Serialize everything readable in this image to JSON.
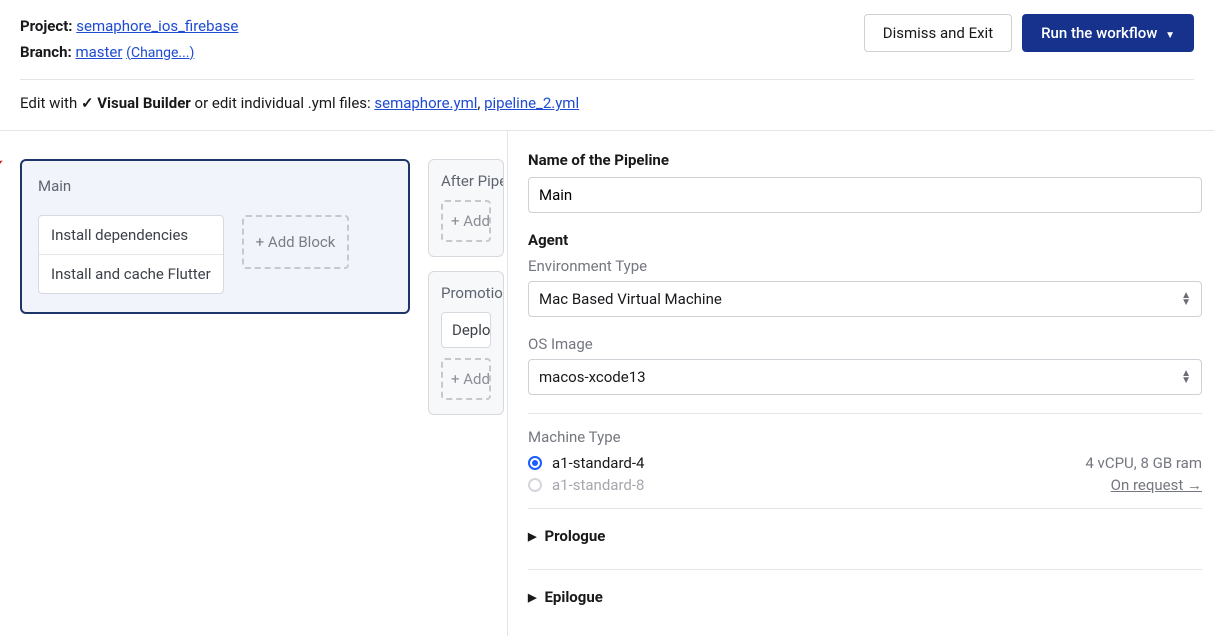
{
  "header": {
    "projectLabel": "Project:",
    "projectName": "semaphore_ios_firebase",
    "branchLabel": "Branch:",
    "branchName": "master",
    "changeLabel": "(Change...)",
    "dismiss": "Dismiss and Exit",
    "run": "Run the workflow"
  },
  "editwith": {
    "prefix": "Edit with",
    "builder": "✓ Visual Builder",
    "middle": " or edit individual .yml files: ",
    "file1": "semaphore.yml",
    "file2": "pipeline_2.yml"
  },
  "mainPipeline": {
    "title": "Main",
    "jobs": [
      "Install dependencies",
      "Install and cache Flutter"
    ],
    "addBlock": "+ Add Block"
  },
  "afterCard": {
    "title": "After Pipeline",
    "add": "+ Add"
  },
  "promotionsCard": {
    "title": "Promotions",
    "item": "Deploy t",
    "add": "+ Add"
  },
  "panel": {
    "nameLabel": "Name of the Pipeline",
    "nameValue": "Main",
    "agentLabel": "Agent",
    "envLabel": "Environment Type",
    "envValue": "Mac Based Virtual Machine",
    "osLabel": "OS Image",
    "osValue": "macos-xcode13",
    "machineLabel": "Machine Type",
    "machines": [
      {
        "name": "a1-standard-4",
        "spec": "4 vCPU, 8 GB ram",
        "checked": true,
        "disabled": false,
        "link": false
      },
      {
        "name": "a1-standard-8",
        "spec": "On request →",
        "checked": false,
        "disabled": true,
        "link": true
      }
    ],
    "prologue": "Prologue",
    "epilogue": "Epilogue"
  }
}
